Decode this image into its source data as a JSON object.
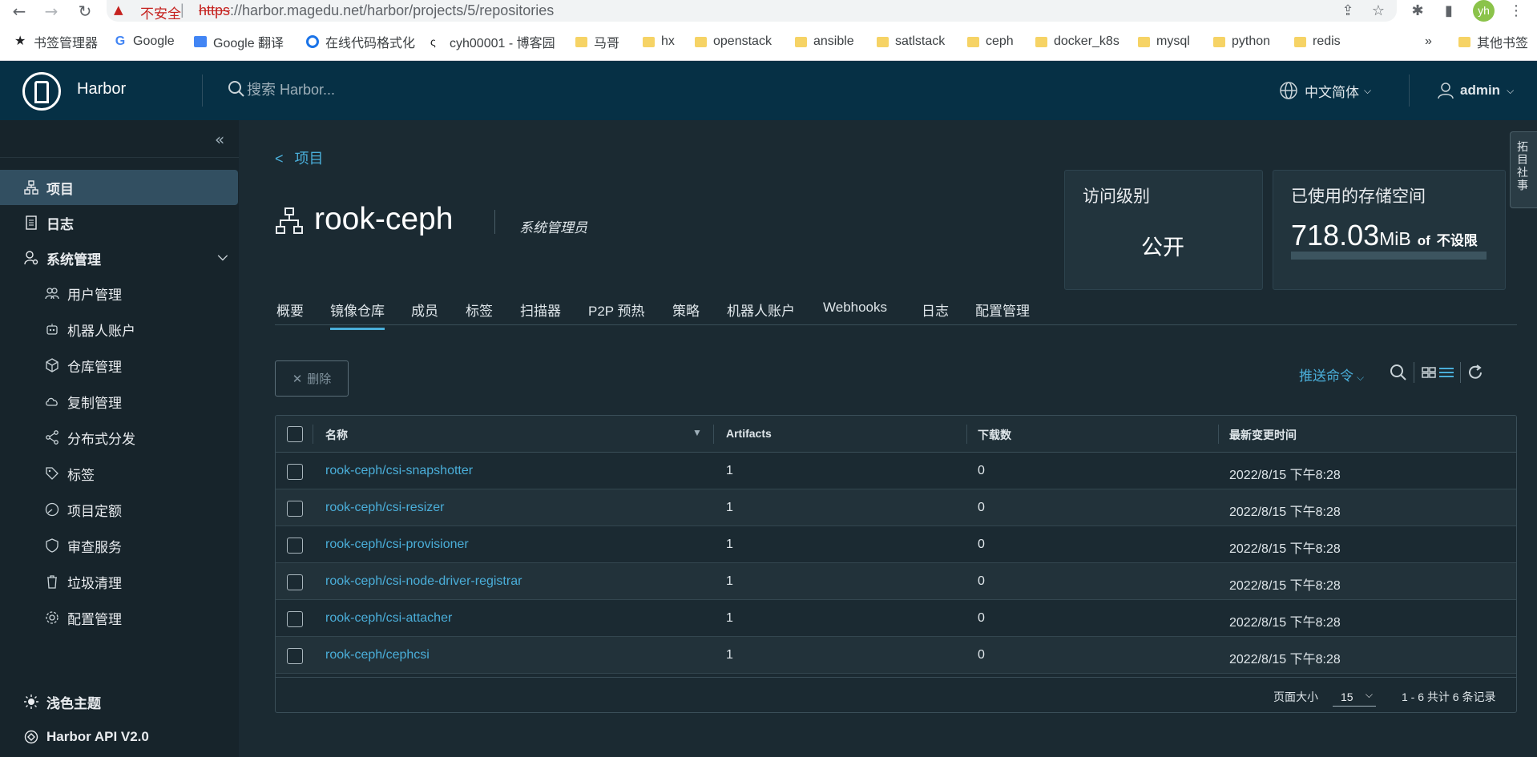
{
  "browser": {
    "insecure_label": "不安全",
    "url_scheme": "https",
    "url_rest": "://harbor.magedu.net/harbor/projects/5/repositories",
    "profile_initials": "yh",
    "bookmarks": [
      {
        "label": "书签管理器",
        "icon": "star-icon"
      },
      {
        "label": "Google",
        "icon": "google-icon"
      },
      {
        "label": "Google 翻译",
        "icon": "translate-icon"
      },
      {
        "label": "在线代码格式化",
        "icon": "format-icon"
      },
      {
        "label": "cyh00001 - 博客园",
        "icon": "blog-icon"
      },
      {
        "label": "马哥",
        "icon": "folder-icon"
      },
      {
        "label": "hx",
        "icon": "folder-icon"
      },
      {
        "label": "openstack",
        "icon": "folder-icon"
      },
      {
        "label": "ansible",
        "icon": "folder-icon"
      },
      {
        "label": "satlstack",
        "icon": "folder-icon"
      },
      {
        "label": "ceph",
        "icon": "folder-icon"
      },
      {
        "label": "docker_k8s",
        "icon": "folder-icon"
      },
      {
        "label": "mysql",
        "icon": "folder-icon"
      },
      {
        "label": "python",
        "icon": "folder-icon"
      },
      {
        "label": "redis",
        "icon": "folder-icon"
      }
    ],
    "more_bookmarks": "»",
    "other_bookmarks": "其他书签"
  },
  "header": {
    "brand": "Harbor",
    "search_placeholder": "搜索 Harbor...",
    "language": "中文简体",
    "user": "admin"
  },
  "sidebar": {
    "collapse_glyph": "«",
    "items": [
      {
        "label": "项目",
        "level": "top",
        "active": true,
        "icon": "projects-icon"
      },
      {
        "label": "日志",
        "level": "top",
        "active": false,
        "icon": "logs-icon"
      },
      {
        "label": "系统管理",
        "level": "top",
        "active": false,
        "icon": "admin-icon"
      },
      {
        "label": "用户管理",
        "level": "sub",
        "icon": "users-icon"
      },
      {
        "label": "机器人账户",
        "level": "sub",
        "icon": "robot-icon"
      },
      {
        "label": "仓库管理",
        "level": "sub",
        "icon": "registry-icon"
      },
      {
        "label": "复制管理",
        "level": "sub",
        "icon": "replication-icon"
      },
      {
        "label": "分布式分发",
        "level": "sub",
        "icon": "distribution-icon"
      },
      {
        "label": "标签",
        "level": "sub",
        "icon": "tag-icon"
      },
      {
        "label": "项目定额",
        "level": "sub",
        "icon": "quota-icon"
      },
      {
        "label": "审查服务",
        "level": "sub",
        "icon": "shield-icon"
      },
      {
        "label": "垃圾清理",
        "level": "sub",
        "icon": "trash-icon"
      },
      {
        "label": "配置管理",
        "level": "sub",
        "icon": "gear-icon"
      }
    ],
    "theme_label": "浅色主题",
    "api_label": "Harbor API V2.0"
  },
  "project": {
    "back_label": "项目",
    "name": "rook-ceph",
    "role": "系统管理员",
    "access_title": "访问级别",
    "access_value": "公开",
    "storage_title": "已使用的存储空间",
    "storage_value": "718.03",
    "storage_unit": "MiB",
    "storage_of": "of",
    "storage_limit": "不设限"
  },
  "tabs": [
    {
      "label": "概要",
      "active": false
    },
    {
      "label": "镜像仓库",
      "active": true
    },
    {
      "label": "成员",
      "active": false
    },
    {
      "label": "标签",
      "active": false
    },
    {
      "label": "扫描器",
      "active": false
    },
    {
      "label": "P2P 预热",
      "active": false
    },
    {
      "label": "策略",
      "active": false
    },
    {
      "label": "机器人账户",
      "active": false
    },
    {
      "label": "Webhooks",
      "active": false
    },
    {
      "label": "日志",
      "active": false
    },
    {
      "label": "配置管理",
      "active": false
    }
  ],
  "toolbar": {
    "delete_label": "删除",
    "push_command": "推送命令"
  },
  "table": {
    "columns": [
      "名称",
      "Artifacts",
      "下载数",
      "最新变更时间"
    ],
    "rows": [
      {
        "name": "rook-ceph/csi-snapshotter",
        "artifacts": "1",
        "pulls": "0",
        "updated": "2022/8/15 下午8:28"
      },
      {
        "name": "rook-ceph/csi-resizer",
        "artifacts": "1",
        "pulls": "0",
        "updated": "2022/8/15 下午8:28"
      },
      {
        "name": "rook-ceph/csi-provisioner",
        "artifacts": "1",
        "pulls": "0",
        "updated": "2022/8/15 下午8:28"
      },
      {
        "name": "rook-ceph/csi-node-driver-registrar",
        "artifacts": "1",
        "pulls": "0",
        "updated": "2022/8/15 下午8:28"
      },
      {
        "name": "rook-ceph/csi-attacher",
        "artifacts": "1",
        "pulls": "0",
        "updated": "2022/8/15 下午8:28"
      },
      {
        "name": "rook-ceph/cephcsi",
        "artifacts": "1",
        "pulls": "0",
        "updated": "2022/8/15 下午8:28"
      }
    ],
    "page_size_label": "页面大小",
    "page_size": "15",
    "summary": "1 - 6 共计 6 条记录"
  },
  "side_tab_label": "拓目社事"
}
